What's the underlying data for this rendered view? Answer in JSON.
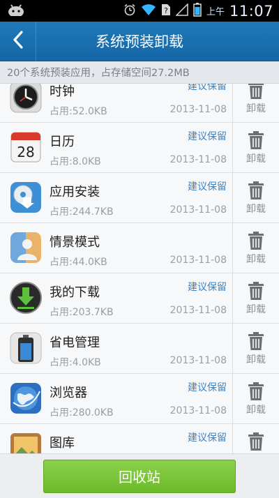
{
  "status_bar": {
    "ampm": "上午",
    "time": "11:07",
    "icons": [
      "android-icon",
      "alarm-icon",
      "wifi-icon",
      "no-sim-icon",
      "signal-icon",
      "battery-icon"
    ]
  },
  "title_bar": {
    "back_icon": "back-arrow-icon",
    "title": "系统预装卸载"
  },
  "summary": "20个系统预装应用，占存储空间27.2MB",
  "uninstall_label": "卸载",
  "apps": [
    {
      "name": "时钟",
      "size": "占用:52.0KB",
      "date": "2013-11-08",
      "suggest": "建议保留",
      "icon": "clock-icon"
    },
    {
      "name": "日历",
      "size": "占用:8.0KB",
      "date": "2013-11-08",
      "suggest": "建议保留",
      "icon": "calendar-icon",
      "icon_text": "28"
    },
    {
      "name": "应用安装",
      "size": "占用:244.7KB",
      "date": "2013-11-08",
      "suggest": "建议保留",
      "icon": "package-installer-icon"
    },
    {
      "name": "情景模式",
      "size": "占用:44.0KB",
      "date": "2013-11-08",
      "suggest": "",
      "icon": "profile-mode-icon"
    },
    {
      "name": "我的下载",
      "size": "占用:203.7KB",
      "date": "2013-11-08",
      "suggest": "建议保留",
      "icon": "download-icon"
    },
    {
      "name": "省电管理",
      "size": "占用:4.0KB",
      "date": "2013-11-08",
      "suggest": "",
      "icon": "battery-saver-icon"
    },
    {
      "name": "浏览器",
      "size": "占用:280.0KB",
      "date": "2013-11-08",
      "suggest": "建议保留",
      "icon": "browser-globe-icon"
    },
    {
      "name": "图库",
      "size": "",
      "date": "",
      "suggest": "建议保留",
      "icon": "gallery-icon"
    }
  ],
  "bottom_button": "回收站",
  "colors": {
    "title_bar": "#1a6fae",
    "suggest_text": "#3a84c6",
    "recycle_button": "#7cc63a"
  }
}
